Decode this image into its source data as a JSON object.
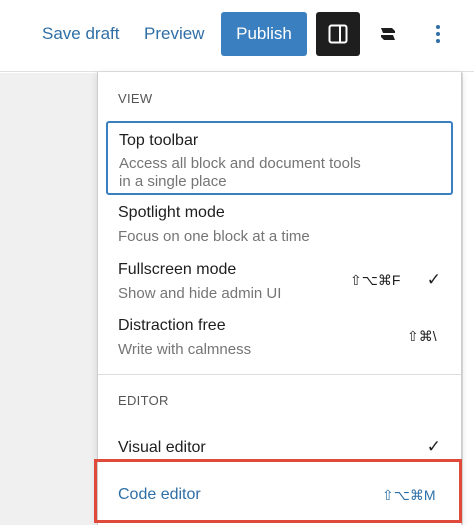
{
  "header": {
    "save_draft": "Save draft",
    "preview": "Preview",
    "publish": "Publish",
    "icons": {
      "settings": "sidebar-toggle-icon",
      "styles": "styles-s-icon",
      "options": "vertical-ellipsis-icon"
    }
  },
  "menu": {
    "view_label": "VIEW",
    "editor_label": "EDITOR",
    "view_items": [
      {
        "title": "Top toolbar",
        "description": "Access all block and document tools",
        "description_2": "in a single place"
      },
      {
        "title": "Spotlight mode",
        "description": "Focus on one block at a time"
      },
      {
        "title": "Fullscreen mode",
        "description": "Show and hide admin UI",
        "shortcut": "⇧⌥⌘F",
        "checked": "✓"
      },
      {
        "title": "Distraction free",
        "description": "Write with calmness",
        "shortcut": "⇧⌘\\"
      }
    ],
    "editor_items": [
      {
        "title": "Visual editor",
        "checked": "✓"
      },
      {
        "title": "Code editor",
        "shortcut": "⇧⌥⌘M"
      }
    ]
  },
  "colors": {
    "accent": "#3a7fbf",
    "link": "#2f6fa6",
    "highlight": "#e04a3a",
    "dark_button": "#1e1e1e"
  }
}
